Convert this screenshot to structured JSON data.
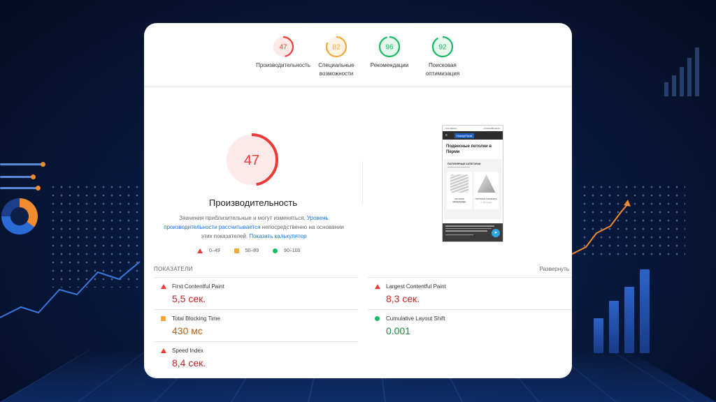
{
  "summary_gauges": [
    {
      "score": "47",
      "label_lines": [
        "Производительность"
      ],
      "color": "#eb3b38",
      "fill": "#fde9e8",
      "fraction": 0.47
    },
    {
      "score": "82",
      "label_lines": [
        "Специальные",
        "возможности"
      ],
      "color": "#f4a83a",
      "fill": "#fff4e3",
      "fraction": 0.82
    },
    {
      "score": "96",
      "label_lines": [
        "Рекомендации"
      ],
      "color": "#19b862",
      "fill": "#e6f8ee",
      "fraction": 0.96
    },
    {
      "score": "92",
      "label_lines": [
        "Поисковая",
        "оптимизация"
      ],
      "color": "#19b862",
      "fill": "#e6f8ee",
      "fraction": 0.92
    }
  ],
  "performance": {
    "score": "47",
    "fraction": 0.47,
    "color": "#eb3b38",
    "title": "Производительность",
    "desc_part1": "Значения приблизительные и могут изменяться. ",
    "desc_link1": "Уровень производительности рассчитывается",
    "desc_part2": " непосредственно на основании этих показателей. ",
    "desc_link2": "Показать калькулятор"
  },
  "legend": [
    {
      "shape": "triangle",
      "label": "0–49"
    },
    {
      "shape": "square",
      "label": "50–89"
    },
    {
      "shape": "circle",
      "label": "90–100"
    }
  ],
  "screenshot_preview": {
    "status_left": "9:41 МЕНЮ",
    "status_right": "+7(342)288-40-00",
    "logo": "НомерПерм",
    "heading": "Подвесные потолки в Перми",
    "category": "ПОПУЛЯРНЫЕ КАТЕГОРИИ",
    "tiles": [
      {
        "title": "ПОТОЛКИ ARMSTRONG",
        "sub": "от 360 руб/м2"
      },
      {
        "title": "ПОТОЛОК ГРИЛЬЯТО",
        "sub": "от 360 руб/м2"
      }
    ]
  },
  "metrics": {
    "header": "ПОКАЗАТЕЛИ",
    "expand_label": "Развернуть",
    "items": [
      {
        "name": "First Contentful Paint",
        "value": "5,5 сек.",
        "status": "red"
      },
      {
        "name": "Largest Contentful Paint",
        "value": "8,3 сек.",
        "status": "red"
      },
      {
        "name": "Total Blocking Time",
        "value": "430 мс",
        "status": "orange"
      },
      {
        "name": "Cumulative Layout Shift",
        "value": "0.001",
        "status": "green"
      },
      {
        "name": "Speed Index",
        "value": "8,4 сек.",
        "status": "red"
      }
    ]
  }
}
